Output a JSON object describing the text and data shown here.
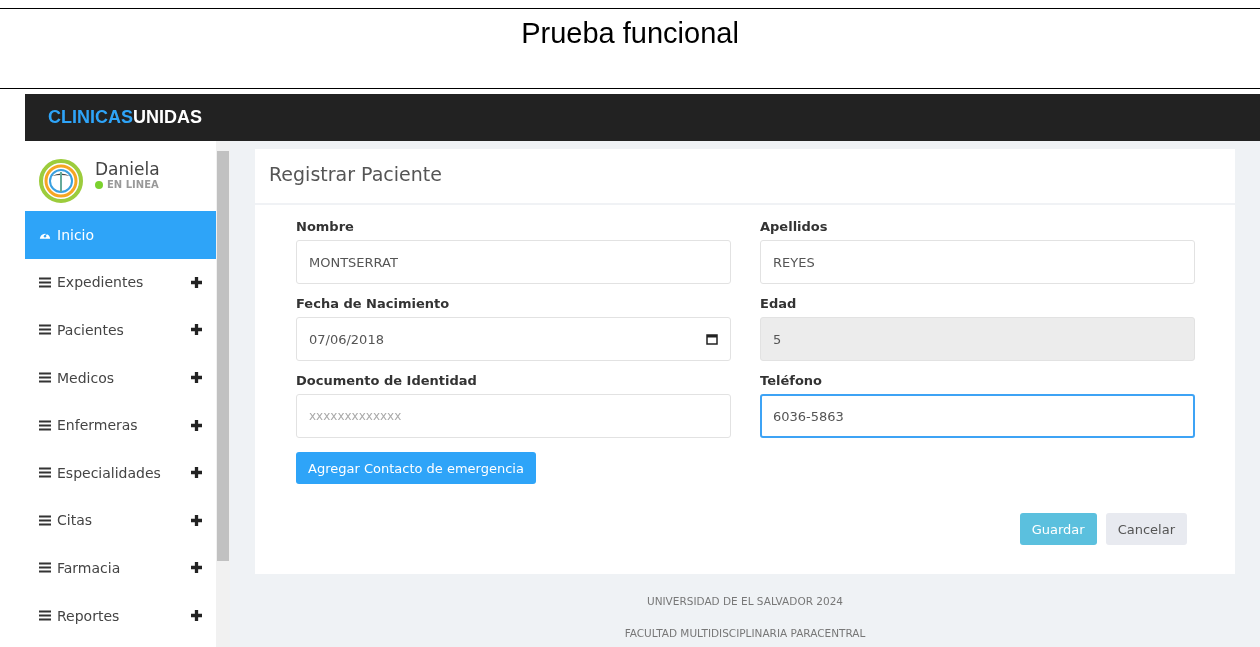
{
  "document": {
    "title": "Prueba funcional"
  },
  "brand": {
    "part_1": "CLINICAS",
    "part_2": "UNIDAS"
  },
  "user": {
    "name": "Daniela",
    "status": "EN LINEA",
    "online": true
  },
  "sidebar": {
    "items": [
      {
        "label": "Inicio",
        "kind": "dashboard",
        "selected": true,
        "expandable": false
      },
      {
        "label": "Expedientes",
        "kind": "menu",
        "selected": false,
        "expandable": true
      },
      {
        "label": "Pacientes",
        "kind": "menu",
        "selected": false,
        "expandable": true
      },
      {
        "label": "Medicos",
        "kind": "menu",
        "selected": false,
        "expandable": true
      },
      {
        "label": "Enfermeras",
        "kind": "menu",
        "selected": false,
        "expandable": true
      },
      {
        "label": "Especialidades",
        "kind": "menu",
        "selected": false,
        "expandable": true
      },
      {
        "label": "Citas",
        "kind": "menu",
        "selected": false,
        "expandable": true
      },
      {
        "label": "Farmacia",
        "kind": "menu",
        "selected": false,
        "expandable": true
      },
      {
        "label": "Reportes",
        "kind": "menu",
        "selected": false,
        "expandable": true
      }
    ]
  },
  "form": {
    "title": "Registrar Paciente",
    "fields": [
      {
        "label": "Nombre",
        "kind": "text",
        "value": "MONTSERRAT",
        "disabled": false,
        "focused": false
      },
      {
        "label": "Apellidos",
        "kind": "text",
        "value": "REYES",
        "disabled": false,
        "focused": false
      },
      {
        "label": "Fecha de Nacimiento",
        "kind": "date",
        "value": "07/06/2018",
        "disabled": false,
        "focused": false
      },
      {
        "label": "Edad",
        "kind": "text",
        "value": "5",
        "disabled": true,
        "focused": false
      },
      {
        "label": "Documento de Identidad",
        "kind": "text",
        "placeholder": "xxxxxxxxxxxxx",
        "disabled": false,
        "focused": false
      },
      {
        "label": "Teléfono",
        "kind": "text",
        "value": "6036-5863",
        "disabled": false,
        "focused": true
      }
    ],
    "emergency_button": "Agregar Contacto de emergencia",
    "buttons": [
      {
        "label": "Guardar",
        "kind": "primary"
      },
      {
        "label": "Cancelar",
        "kind": "secondary"
      }
    ]
  },
  "footer": [
    "UNIVERSIDAD DE EL SALVADOR 2024",
    "FACULTAD MULTIDISCIPLINARIA PARACENTRAL"
  ]
}
